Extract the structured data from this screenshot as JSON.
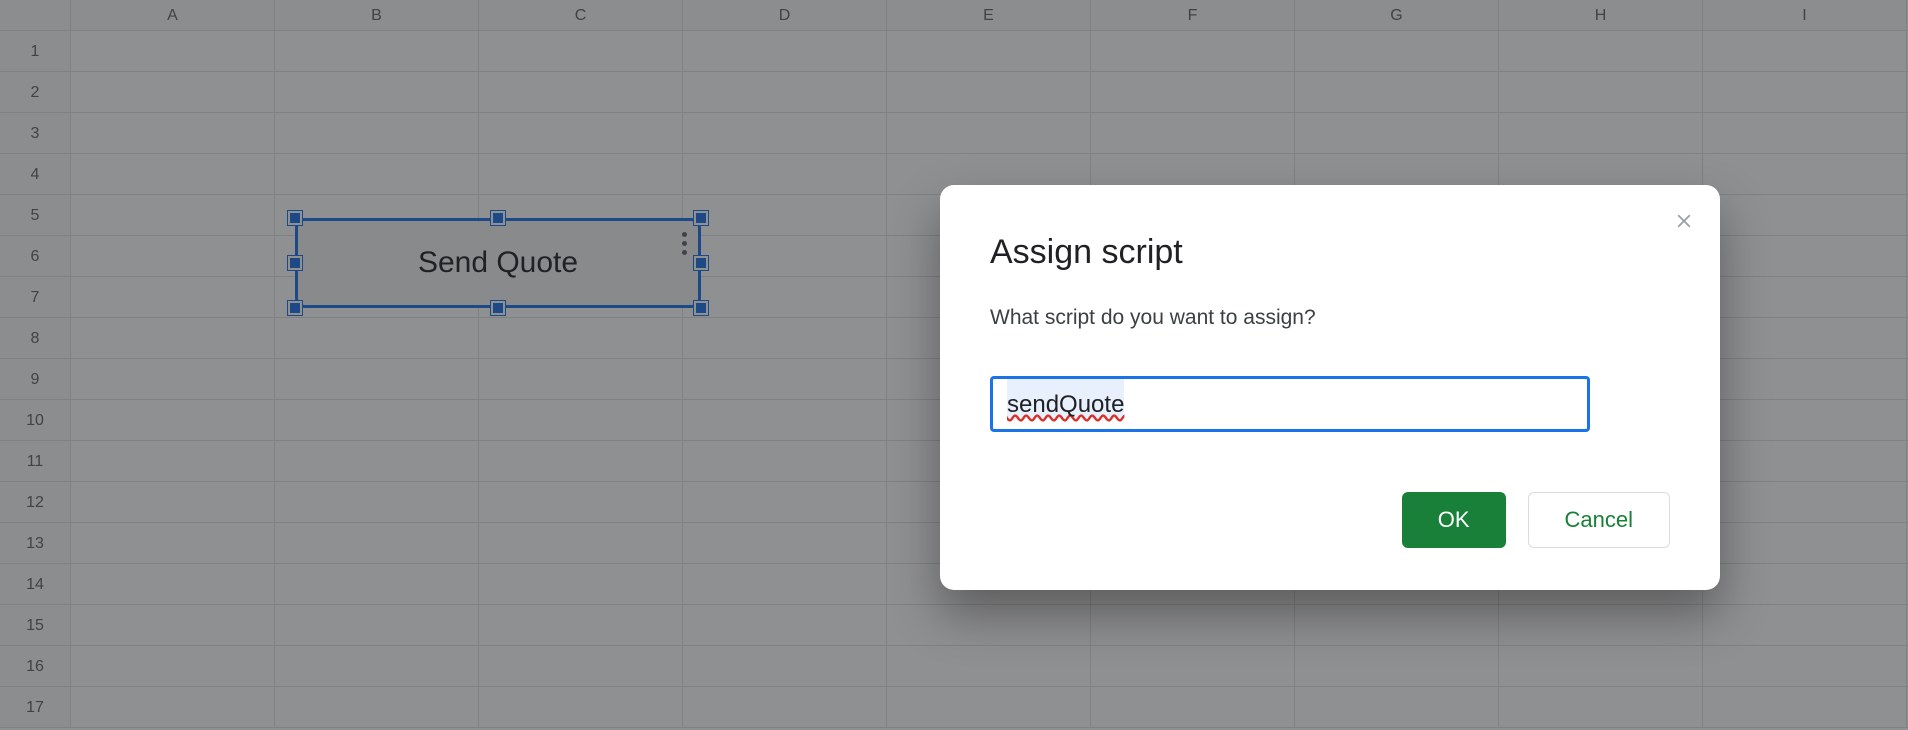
{
  "sheet": {
    "columns": [
      "A",
      "B",
      "C",
      "D",
      "E",
      "F",
      "G",
      "H",
      "I"
    ],
    "row_count": 17,
    "shape": {
      "label": "Send Quote"
    }
  },
  "dialog": {
    "title": "Assign script",
    "prompt": "What script do you want to assign?",
    "input_value": "sendQuote",
    "ok_label": "OK",
    "cancel_label": "Cancel"
  }
}
